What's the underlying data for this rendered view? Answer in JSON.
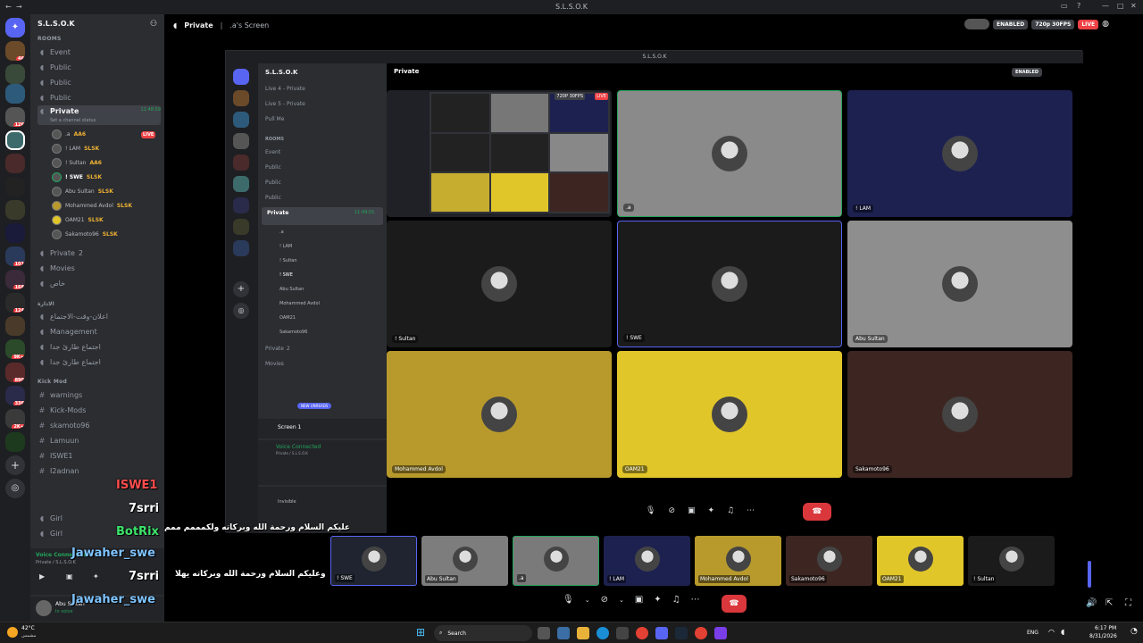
{
  "titlebar": {
    "title": "S.L.S.O.K"
  },
  "server": {
    "name": "S.L.S.O.K"
  },
  "sidebar": {
    "rooms_label": "ROOMS",
    "channels": [
      {
        "icon": "speaker",
        "label": "Event"
      },
      {
        "icon": "speaker",
        "label": "Public"
      },
      {
        "icon": "speaker",
        "label": "Public"
      },
      {
        "icon": "speaker",
        "label": "Public"
      },
      {
        "icon": "speaker",
        "label": "Private",
        "time": "11:48:59",
        "status": "Set a channel status"
      }
    ],
    "voice_users": [
      {
        "name": ".a",
        "tag": "AA6",
        "live": "LIVE"
      },
      {
        "name": "! LAM",
        "tag": "SLSK"
      },
      {
        "name": "! Sultan",
        "tag": "AA6"
      },
      {
        "name": "! SWE",
        "tag": "SLSK"
      },
      {
        "name": "Abu Sultan",
        "tag": "SLSK"
      },
      {
        "name": "Mohammed Avdol",
        "tag": "SLSK"
      },
      {
        "name": "OAM21",
        "tag": "SLSK"
      },
      {
        "name": "Sakamoto96",
        "tag": "SLSK"
      }
    ],
    "private2": {
      "label": "Private",
      "count": "2"
    },
    "movies": "Movies",
    "arabic_room": "خاص",
    "admin_cat": "الادارة",
    "admin_channels": [
      "اعلان-وقت-الاجتماع",
      "Management",
      "اجتماع طارئ جدا",
      "اجتماع طارئ جدا"
    ],
    "kick_cat": "Kick Mod",
    "kick_channels": [
      "warnings",
      "Kick-Mods",
      "skamoto96",
      "Lamuun",
      "ISWE1",
      "I2adnan"
    ],
    "extra_channels": [
      "Girl",
      "Girl"
    ],
    "voice_connected": "Voice Connected",
    "voice_sub": "Private / S.L.S.O.K",
    "user": {
      "name": "Abu Sultan",
      "status": "In voice"
    }
  },
  "main_header": {
    "channel": "Private",
    "screen": ".a's Screen",
    "enabled": "ENABLED",
    "quality": "720p 30FPS",
    "live": "LIVE"
  },
  "inner": {
    "title": "S.L.S.O.K",
    "channel": "Private",
    "enabled": "ENABLED",
    "quality": "720P 30FPS",
    "live": "LIVE",
    "server_name": "S.L.S.O.K",
    "channels": [
      "Live 4 - Private",
      "Live 5 - Private",
      "Pull Me",
      "ROOMS",
      "Event",
      "Public",
      "Public",
      "Public",
      "Private"
    ],
    "private_time": "11:49:01",
    "voice_users": [
      ".a",
      "! LAM",
      "! Sultan",
      "! SWE",
      "Abu Sultan",
      "Mohammed Avdol",
      "OAM21",
      "Sakamoto96"
    ],
    "private2": "Private",
    "private2_count": "2",
    "movies": "Movies",
    "new_unreads": "NEW UNREADS",
    "screen_label": "Screen 1",
    "voice_connected": "Voice Connected",
    "voice_sub": "Private / S.L.S.O.K",
    "user_name": "Invisible",
    "tiles": [
      {
        "name": "",
        "color": "#1f2126"
      },
      {
        "name": ".a",
        "color": "#8a8a8a"
      },
      {
        "name": "! LAM",
        "color": "#1d2150"
      },
      {
        "name": "! Sultan",
        "color": "#1b1b1b"
      },
      {
        "name": "! SWE",
        "color": "#1b1b1b"
      },
      {
        "name": "Abu Sultan",
        "color": "#8e8e8e"
      },
      {
        "name": "Mohammed Avdol",
        "color": "#b89a2c"
      },
      {
        "name": "OAM21",
        "color": "#e1c62a"
      },
      {
        "name": "Sakamoto96",
        "color": "#3d2622"
      }
    ]
  },
  "strip": [
    {
      "name": "! SWE",
      "color": "#1f2430"
    },
    {
      "name": "Abu Sultan",
      "color": "#7d7d7d"
    },
    {
      "name": ".a",
      "color": "#7a7a7a"
    },
    {
      "name": "! LAM",
      "color": "#1d2150"
    },
    {
      "name": "Mohammed Avdol",
      "color": "#b89a2c"
    },
    {
      "name": "Sakamoto96",
      "color": "#3d2622"
    },
    {
      "name": "OAM21",
      "color": "#e1c62a"
    },
    {
      "name": "! Sultan",
      "color": "#1b1b1b"
    }
  ],
  "chat": [
    {
      "text": "ISWE1",
      "color": "#ff4d4d"
    },
    {
      "text": "7srri",
      "color": "#ffffff"
    },
    {
      "text": "BotRix",
      "color": "#3ce36b"
    },
    {
      "text": "عليكم السلام ورحمة الله وبركاته ولكمممم ممم",
      "color": "#ffffff"
    },
    {
      "text": "Jawaher_swe",
      "color": "#7fc4ff"
    },
    {
      "text": "7srri",
      "color": "#ffffff"
    },
    {
      "text": "وعليكم السلام ورحمة الله وبركاته يهلا",
      "color": "#ffffff"
    },
    {
      "text": "Jawaher_swe",
      "color": "#7fc4ff"
    }
  ],
  "taskbar": {
    "weather": "42°C",
    "weather_sub": "مشمس",
    "search": "Search",
    "lang": "ENG",
    "time": "6:17 PM",
    "date": "8/31/2026"
  },
  "colors": {
    "live": "#ed4245",
    "enabled": "#3f4147",
    "hangup": "#da373c"
  }
}
